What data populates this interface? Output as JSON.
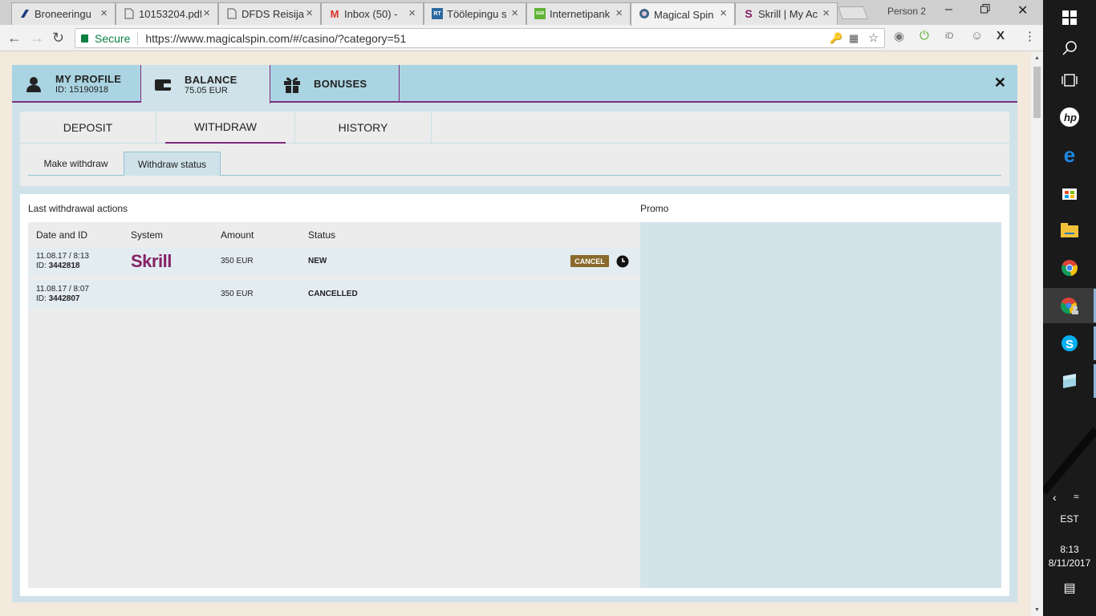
{
  "browser": {
    "tabs": [
      {
        "title": "Broneeringu",
        "favicon": "dfds-icon"
      },
      {
        "title": "10153204.pdf",
        "favicon": "document-icon"
      },
      {
        "title": "DFDS Reisija",
        "favicon": "document-icon"
      },
      {
        "title": "Inbox (50) -",
        "favicon": "gmail-icon"
      },
      {
        "title": "Töölepingu s",
        "favicon": "rt-icon"
      },
      {
        "title": "Internetipank",
        "favicon": "seb-icon"
      },
      {
        "title": "Magical Spin",
        "favicon": "magicalspin-icon",
        "active": true
      },
      {
        "title": "Skrill | My Ac",
        "favicon": "skrill-icon"
      }
    ],
    "person": "Person 2",
    "secure_label": "Secure",
    "url": "https://www.magicalspin.com/#/casino/?category=51"
  },
  "topnav": {
    "profile": {
      "title": "MY PROFILE",
      "sub": "ID: 15190918"
    },
    "balance": {
      "title": "BALANCE",
      "sub": "75.05 EUR"
    },
    "bonuses": {
      "title": "BONUSES"
    }
  },
  "tabs": [
    "DEPOSIT",
    "WITHDRAW",
    "HISTORY"
  ],
  "subtabs": [
    "Make withdraw",
    "Withdraw status"
  ],
  "section": {
    "title": "Last withdrawal actions",
    "promo": "Promo"
  },
  "table": {
    "headers": [
      "Date and ID",
      "System",
      "Amount",
      "Status"
    ],
    "rows": [
      {
        "date": "11.08.17 / 8:13",
        "id_label": "ID: ",
        "id": "3442818",
        "system": "Skrill",
        "amount": "350 EUR",
        "status": "NEW",
        "action": "CANCEL"
      },
      {
        "date": "11.08.17 / 8:07",
        "id_label": "ID: ",
        "id": "3442807",
        "system": "",
        "amount": "350 EUR",
        "status": "CANCELLED"
      }
    ]
  },
  "taskbar": {
    "lang": "EST",
    "time": "8:13",
    "date": "8/11/2017"
  },
  "colors": {
    "accent": "#7e2d7e",
    "nav_bg": "#aad4e2",
    "panel_bg": "#cfe2e9",
    "cancel_bg": "#8a6b2c",
    "skrill": "#862165"
  }
}
